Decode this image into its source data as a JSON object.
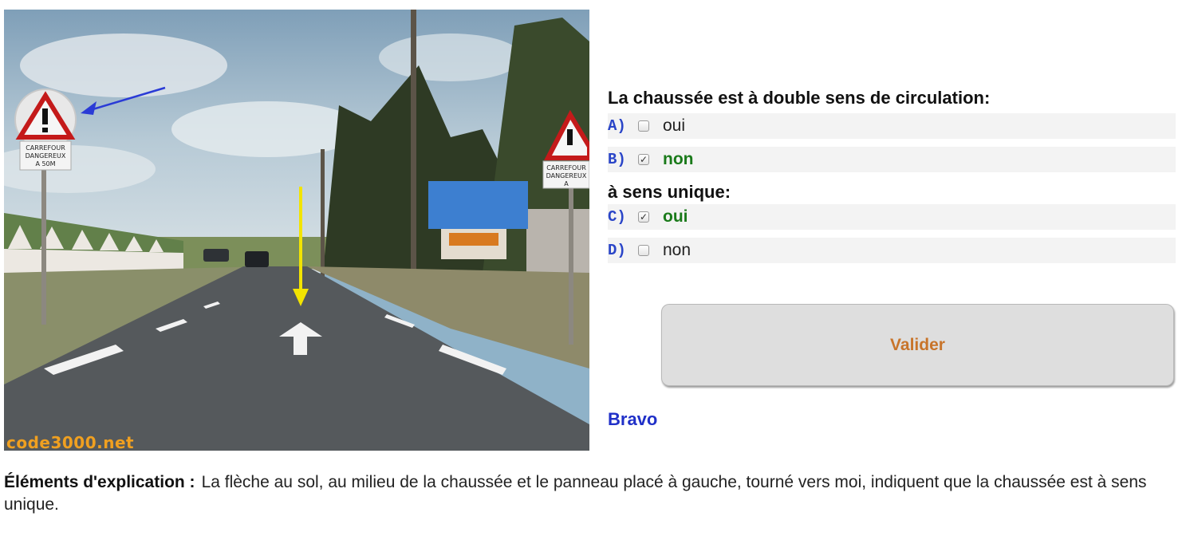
{
  "photo": {
    "alt": "Route avec flèche au sol et panneau Carrefour dangereux",
    "watermark": "code3000.net",
    "sign_left_text": "CARREFOUR DANGEREUX A 50M",
    "sign_right_text": "CARREFOUR DANGEREUX A"
  },
  "questions": [
    {
      "title": "La chaussée est à double sens de circulation:",
      "answers": [
        {
          "letter": "A)",
          "text": "oui",
          "checked": false,
          "correct": false
        },
        {
          "letter": "B)",
          "text": "non",
          "checked": true,
          "correct": true
        }
      ]
    },
    {
      "title": "à sens unique:",
      "answers": [
        {
          "letter": "C)",
          "text": "oui",
          "checked": true,
          "correct": true
        },
        {
          "letter": "D)",
          "text": "non",
          "checked": false,
          "correct": false
        }
      ]
    }
  ],
  "validate_label": "Valider",
  "result": "Bravo",
  "explanation": {
    "label": "Éléments d'explication :",
    "text": "La flèche au sol, au milieu de la chaussée et le panneau placé à gauche, tourné vers moi, indiquent que la chaussée est à sens unique."
  },
  "colors": {
    "letter": "#2a45c8",
    "correct": "#1a7a1a",
    "button_text": "#c8742a",
    "result": "#2030c8"
  }
}
